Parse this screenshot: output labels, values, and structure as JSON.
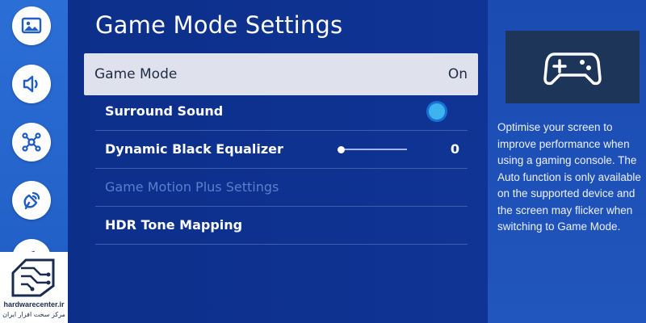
{
  "rail": {
    "icons": [
      "picture-icon",
      "sound-icon",
      "network-icon",
      "broadcasting-icon",
      "support-icon"
    ]
  },
  "watermark": {
    "site": "hardwarecenter.ir",
    "subtitle": "مرکز سخت افزار ایران"
  },
  "main": {
    "title": "Game Mode Settings",
    "rows": [
      {
        "label": "Game Mode",
        "value": "On"
      },
      {
        "label": "Surround Sound"
      },
      {
        "label": "Dynamic Black Equalizer",
        "value": "0",
        "level": 0
      },
      {
        "label": "Game Motion Plus Settings"
      },
      {
        "label": "HDR Tone Mapping"
      }
    ]
  },
  "info": {
    "icon": "gamepad-icon",
    "description": "Optimise your screen to improve performance when using a gaming console. The Auto function is only available on the supported device and the screen may flicker when switching to Game Mode."
  },
  "colors": {
    "accent": "#3db4f0",
    "rail": "#2464cc",
    "main_bg": "#0d3089",
    "focus_row": "#dfe2ec"
  }
}
